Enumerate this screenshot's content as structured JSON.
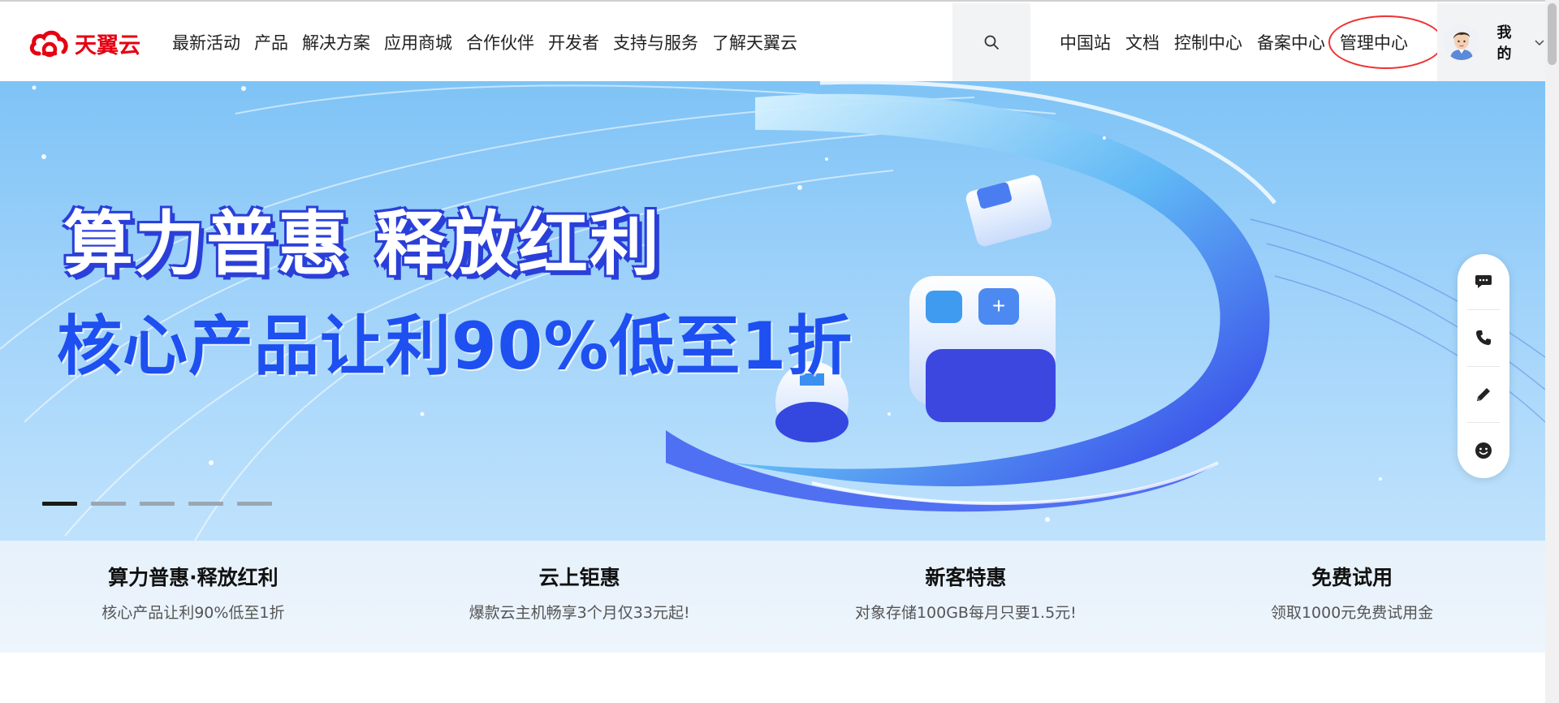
{
  "brand": {
    "name": "天翼云",
    "color": "#e60012"
  },
  "nav": {
    "items": [
      "最新活动",
      "产品",
      "解决方案",
      "应用商城",
      "合作伙伴",
      "开发者",
      "支持与服务",
      "了解天翼云"
    ]
  },
  "search": {
    "icon": "search-icon"
  },
  "right_nav": {
    "items": [
      "中国站",
      "文档",
      "控制中心",
      "备案中心",
      "管理中心"
    ]
  },
  "user": {
    "label": "我的",
    "avatar_icon": "avatar"
  },
  "banner": {
    "title": "算力普惠 释放红利",
    "subtitle": "核心产品让利90%低至1折",
    "slides_count": 5,
    "active_slide": 1
  },
  "floating_bar": {
    "icons": [
      "chat-icon",
      "phone-icon",
      "pen-icon",
      "smile-icon"
    ]
  },
  "promos": [
    {
      "title": "算力普惠·释放红利",
      "subtitle": "核心产品让利90%低至1折"
    },
    {
      "title": "云上钜惠",
      "subtitle": "爆款云主机畅享3个月仅33元起!"
    },
    {
      "title": "新客特惠",
      "subtitle": "对象存储100GB每月只要1.5元!"
    },
    {
      "title": "免费试用",
      "subtitle": "领取1000元免费试用金"
    }
  ],
  "colors": {
    "accent": "#1e4ff0",
    "highlight_circle": "#e33333"
  }
}
